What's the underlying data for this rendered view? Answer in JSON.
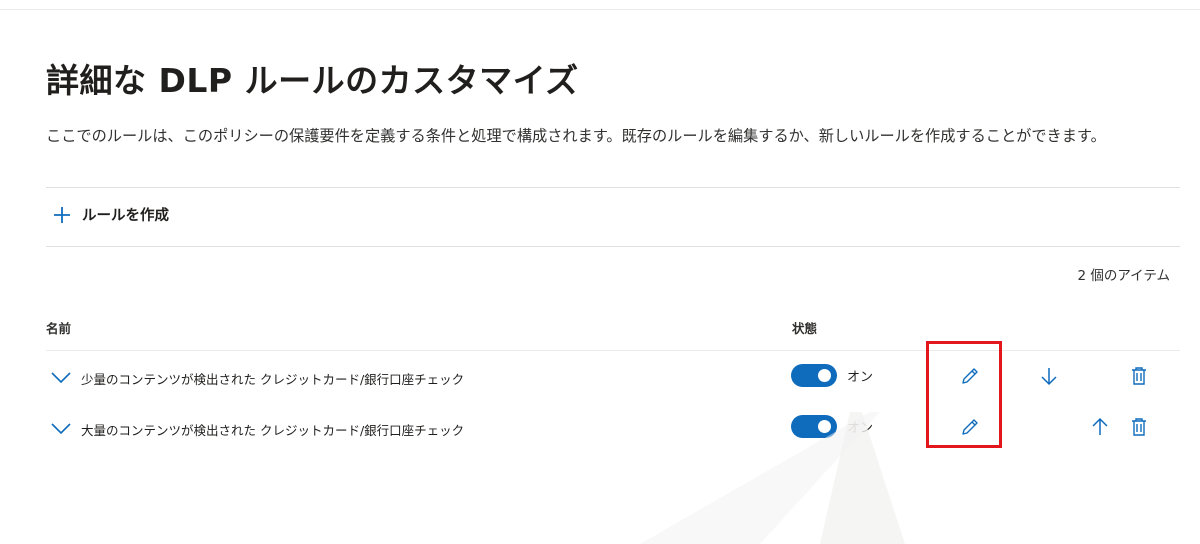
{
  "page": {
    "title": "詳細な DLP ルールのカスタマイズ",
    "description": "ここでのルールは、このポリシーの保護要件を定義する条件と処理で構成されます。既存のルールを編集するか、新しいルールを作成することができます。"
  },
  "toolbar": {
    "create_rule_label": "ルールを作成",
    "create_icon": "plus-icon"
  },
  "list": {
    "item_count": "2 個のアイテム",
    "columns": {
      "name": "名前",
      "status": "状態"
    },
    "rows": [
      {
        "name": "少量のコンテンツが検出された クレジットカード/銀行口座チェック",
        "state": "オン",
        "enabled": true,
        "actions": [
          "edit-icon",
          "arrow-down-icon",
          "delete-icon"
        ]
      },
      {
        "name": "大量のコンテンツが検出された クレジットカード/銀行口座チェック",
        "state": "オン",
        "enabled": true,
        "actions": [
          "edit-icon",
          "arrow-up-icon",
          "delete-icon"
        ]
      }
    ]
  },
  "colors": {
    "accent": "#0f6cbd",
    "highlight": "#e3161b"
  }
}
